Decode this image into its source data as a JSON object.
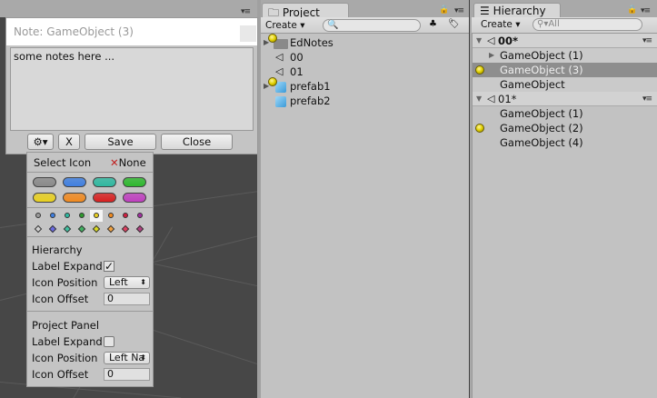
{
  "note_window": {
    "title": "Note: GameObject (3)",
    "text": "some notes here ...",
    "gear_icon": "gear-dropdown-icon",
    "x_label": "X",
    "save_label": "Save",
    "close_label": "Close"
  },
  "icon_menu": {
    "title": "Select Icon",
    "none_label": "None",
    "pill_colors": [
      "#8a8a8a",
      "#3f7fe0",
      "#2fb8a0",
      "#2eb82e",
      "#e8d020",
      "#f08a20",
      "#d82020",
      "#c040c0"
    ],
    "dot_colors": [
      "#9a9a9a",
      "#3f7fe0",
      "#2fb8a0",
      "#2e9a2e",
      "#e8d020",
      "#f08a20",
      "#d02040",
      "#a030a0"
    ],
    "diamond_colors": [
      "#d0d0d0",
      "#6a6ae0",
      "#40c0a0",
      "#40b060",
      "#d8d820",
      "#f0a040",
      "#e04060",
      "#b04080"
    ],
    "selected_dot_index": 4,
    "hierarchy": {
      "heading": "Hierarchy",
      "label_expand": "Label Expand",
      "label_expand_checked": true,
      "icon_position_label": "Icon Position",
      "icon_position_value": "Left",
      "icon_offset_label": "Icon Offset",
      "icon_offset_value": "0"
    },
    "project_panel": {
      "heading": "Project Panel",
      "label_expand": "Label Expand",
      "label_expand_checked": false,
      "icon_position_label": "Icon Position",
      "icon_position_value": "Left Na",
      "icon_offset_label": "Icon Offset",
      "icon_offset_value": "0"
    }
  },
  "project": {
    "tab": "Project",
    "create_label": "Create",
    "search_placeholder": "",
    "items": [
      {
        "name": "EdNotes",
        "type": "folder",
        "note": true
      },
      {
        "name": "00",
        "type": "scene"
      },
      {
        "name": "01",
        "type": "scene"
      },
      {
        "name": "prefab1",
        "type": "prefab",
        "note": true
      },
      {
        "name": "prefab2",
        "type": "prefab"
      }
    ]
  },
  "hierarchy": {
    "tab": "Hierarchy",
    "create_label": "Create",
    "search_placeholder": "All",
    "scenes": [
      {
        "name": "00*",
        "objects": [
          {
            "name": "GameObject (1)",
            "expandable": true
          },
          {
            "name": "GameObject (3)",
            "selected": true,
            "note": true
          },
          {
            "name": "GameObject"
          }
        ]
      },
      {
        "name": "01*",
        "objects": [
          {
            "name": "GameObject (1)"
          },
          {
            "name": "GameObject (2)",
            "note": true
          },
          {
            "name": "GameObject (4)"
          }
        ]
      }
    ]
  }
}
